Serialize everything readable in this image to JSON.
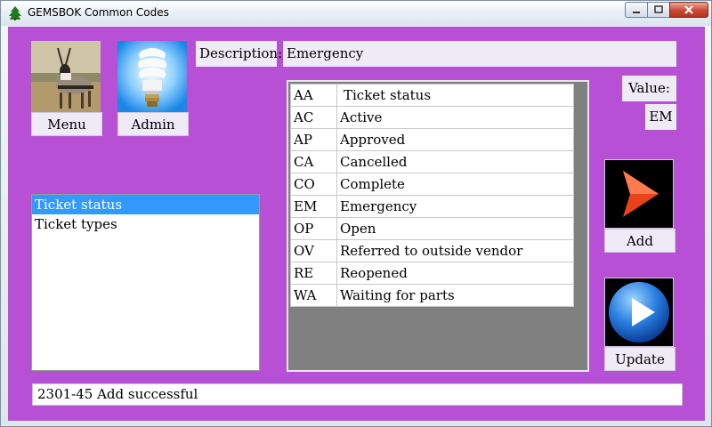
{
  "window": {
    "title": "GEMSBOK Common Codes",
    "app_icon": "tree-icon",
    "controls": [
      "minimize-icon",
      "maximize-icon",
      "close-icon"
    ]
  },
  "colors": {
    "client_background": "#b750d4",
    "panel": "#eeebf7",
    "selection": "#3399ff",
    "grid_frame": "#808080"
  },
  "nav": {
    "menu_label": "Menu",
    "admin_label": "Admin",
    "menu_icon": "gemsbok-photo-icon",
    "admin_icon": "lightbulb-icon"
  },
  "description": {
    "label": "Description:",
    "value": "Emergency"
  },
  "value_field": {
    "label": "Value:",
    "value": "EM"
  },
  "types_list": {
    "items": [
      {
        "label": "Ticket status",
        "selected": true
      },
      {
        "label": "Ticket types",
        "selected": false
      }
    ]
  },
  "codes_table": {
    "rows": [
      {
        "code": "AA",
        "desc": "Ticket status"
      },
      {
        "code": "AC",
        "desc": "Active"
      },
      {
        "code": "AP",
        "desc": "Approved"
      },
      {
        "code": "CA",
        "desc": "Cancelled"
      },
      {
        "code": "CO",
        "desc": "Complete"
      },
      {
        "code": "EM",
        "desc": "Emergency"
      },
      {
        "code": "OP",
        "desc": "Open"
      },
      {
        "code": "OV",
        "desc": "Referred to outside vendor"
      },
      {
        "code": "RE",
        "desc": "Reopened"
      },
      {
        "code": "WA",
        "desc": "Waiting for parts"
      }
    ]
  },
  "actions": {
    "add_label": "Add",
    "update_label": "Update",
    "add_icon": "red-arrow-icon",
    "update_icon": "blue-play-icon"
  },
  "status": {
    "message": "2301-45 Add successful"
  }
}
